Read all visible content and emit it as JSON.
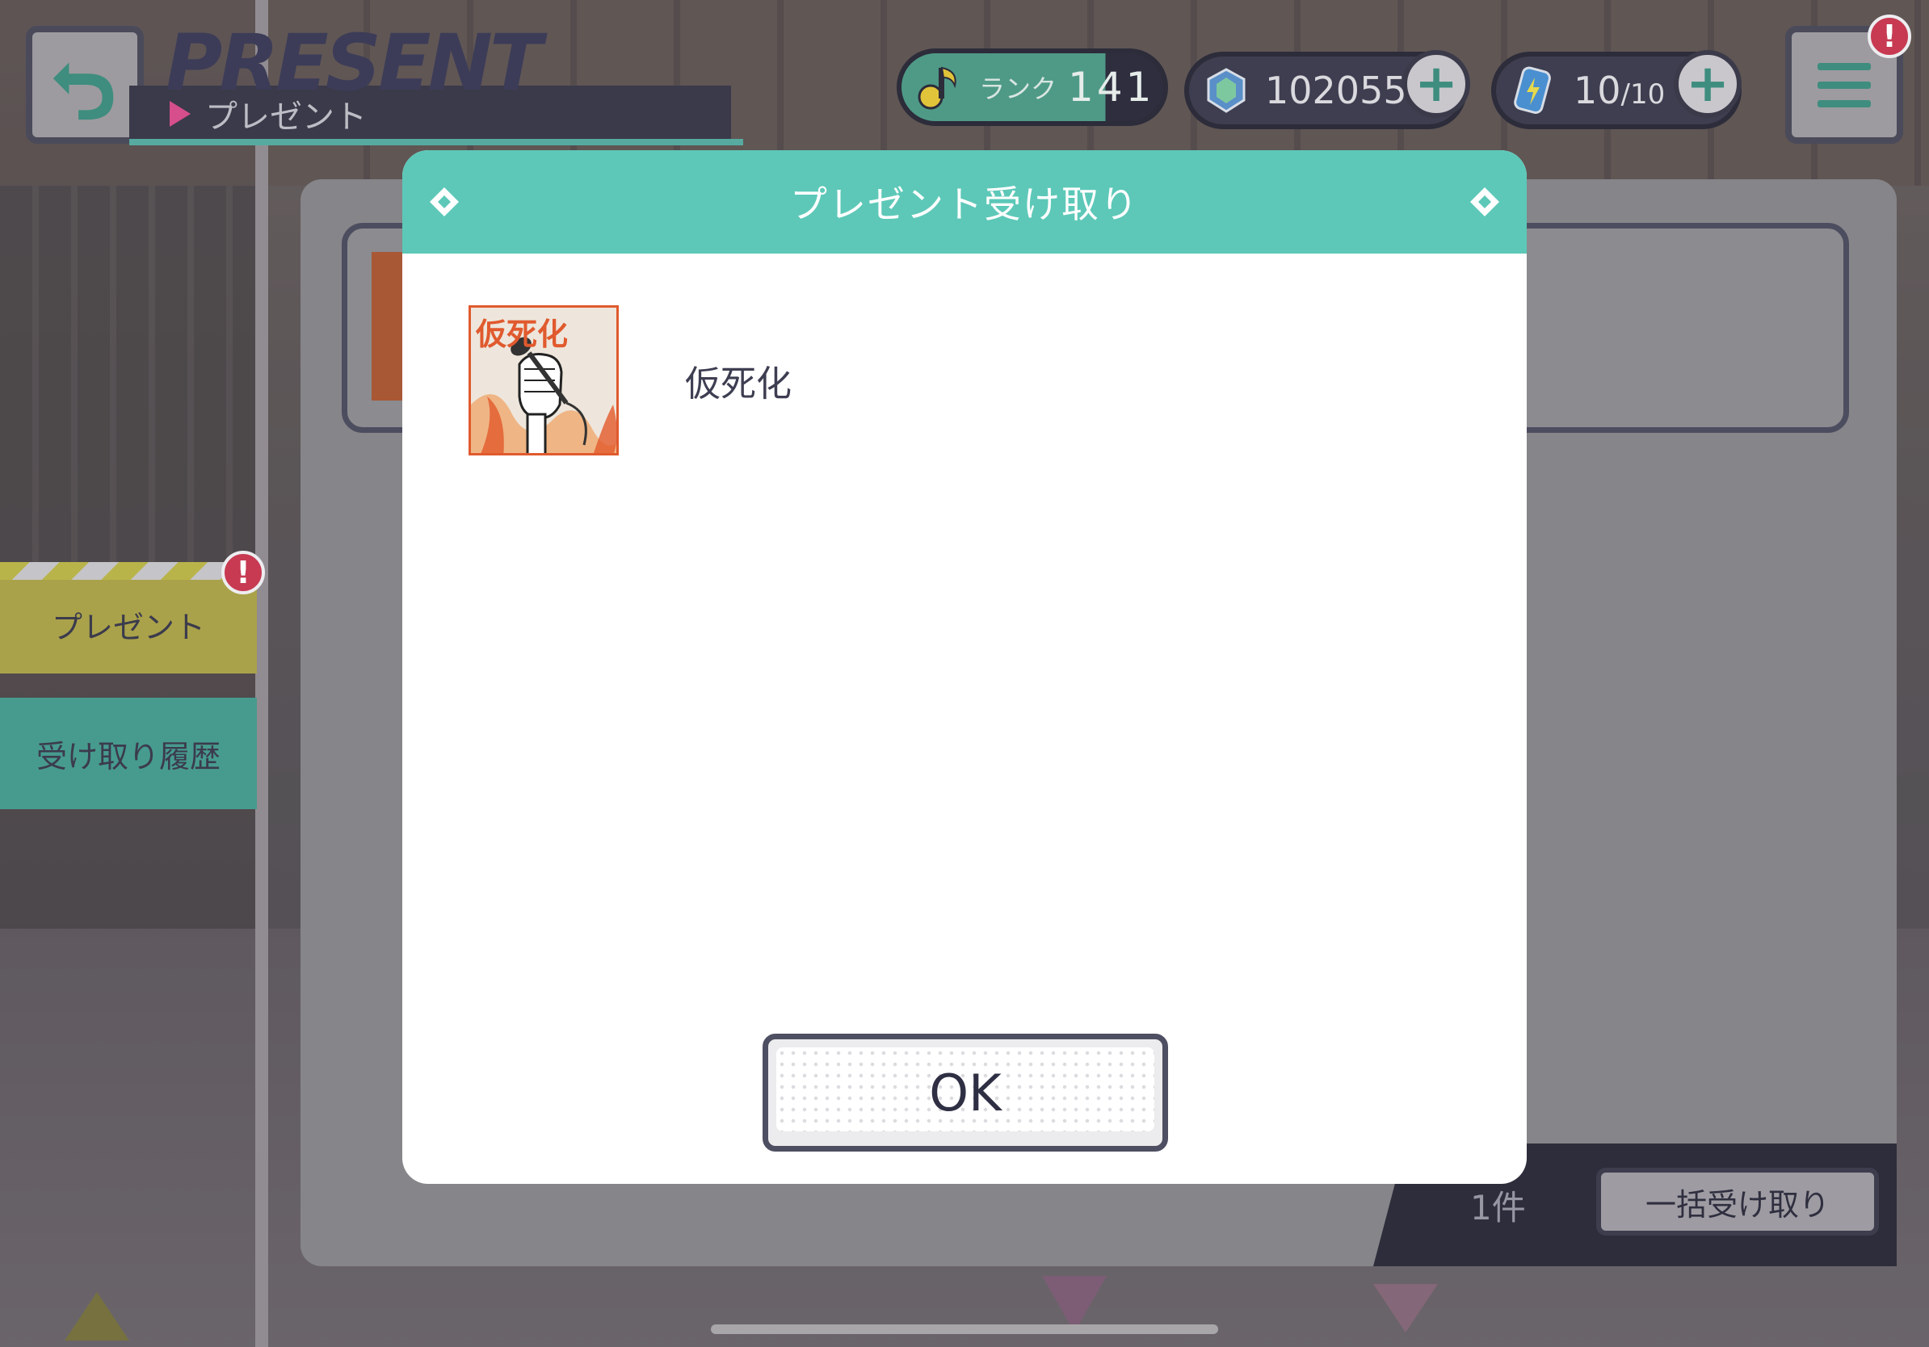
{
  "header": {
    "title_en": "PRESENT",
    "title_jp": "プレゼント"
  },
  "status": {
    "rank_label": "ランク",
    "rank_value": "141",
    "gems": "102055",
    "energy_current": "10",
    "energy_max": "/10",
    "plus_symbol": "+",
    "alert_symbol": "!"
  },
  "sidebar": {
    "items": [
      {
        "label": "プレゼント"
      },
      {
        "label": "受け取り履歴"
      }
    ]
  },
  "list": {
    "count": "1件",
    "bulk_receive_label": "一括受け取り"
  },
  "dialog": {
    "title": "プレゼント受け取り",
    "item_name": "仮死化",
    "jacket_title": "仮死化",
    "ok_label": "OK"
  },
  "colors": {
    "accent_teal": "#5dc8b8",
    "alert_red": "#c73a52",
    "tab_yellow": "#aaa24a",
    "tab_teal": "#479b8e"
  }
}
